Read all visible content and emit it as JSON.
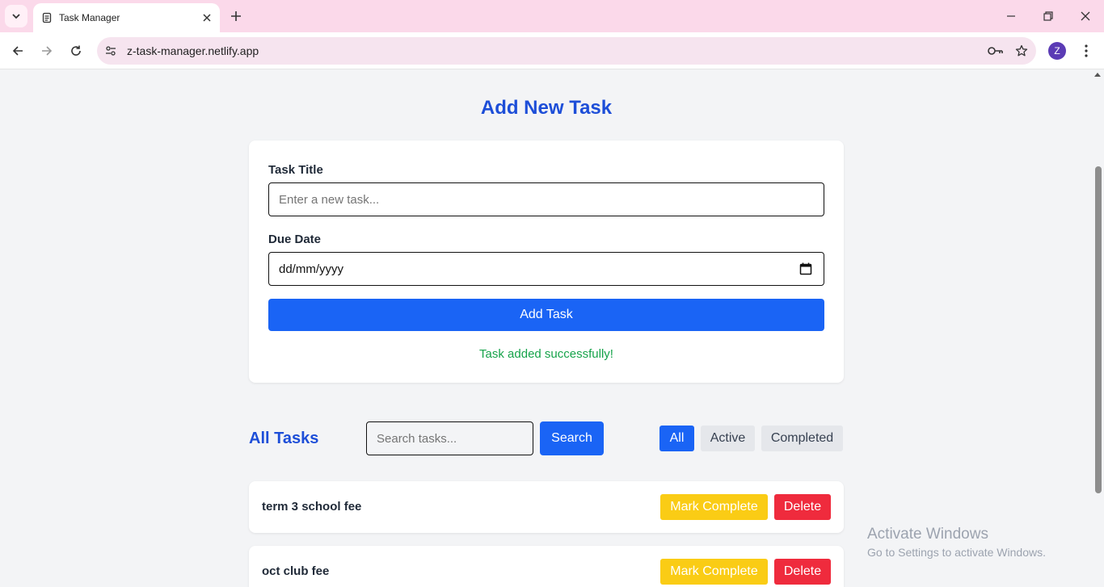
{
  "browser": {
    "tab_title": "Task Manager",
    "url": "z-task-manager.netlify.app",
    "profile_initial": "Z",
    "icons": [
      "tab-list-icon",
      "document-icon",
      "close-icon",
      "plus-icon",
      "minimize-icon",
      "restore-icon",
      "window-close-icon",
      "back-icon",
      "forward-icon",
      "reload-icon",
      "site-info-icon",
      "password-key-icon",
      "star-icon",
      "more-vert-icon"
    ]
  },
  "form": {
    "heading": "Add New Task",
    "title_label": "Task Title",
    "title_placeholder": "Enter a new task...",
    "due_label": "Due Date",
    "due_value": "dd/mm/yyyy",
    "add_button": "Add Task",
    "status_message": "Task added successfully!"
  },
  "tasks_section": {
    "heading": "All Tasks",
    "search_placeholder": "Search tasks...",
    "search_button": "Search",
    "filters": [
      {
        "label": "All",
        "active": true
      },
      {
        "label": "Active",
        "active": false
      },
      {
        "label": "Completed",
        "active": false
      }
    ],
    "items": [
      {
        "title": "term 3 school fee",
        "complete_label": "Mark Complete",
        "delete_label": "Delete"
      },
      {
        "title": "oct club fee",
        "complete_label": "Mark Complete",
        "delete_label": "Delete"
      }
    ]
  },
  "watermark": {
    "line1": "Activate Windows",
    "line2": "Go to Settings to activate Windows."
  },
  "colors": {
    "primary": "#1a64f5",
    "heading": "#1d4ed8",
    "success": "#16a34a",
    "warning": "#facc15",
    "danger": "#ef2b3d",
    "titlebar": "#fbd9ea"
  }
}
